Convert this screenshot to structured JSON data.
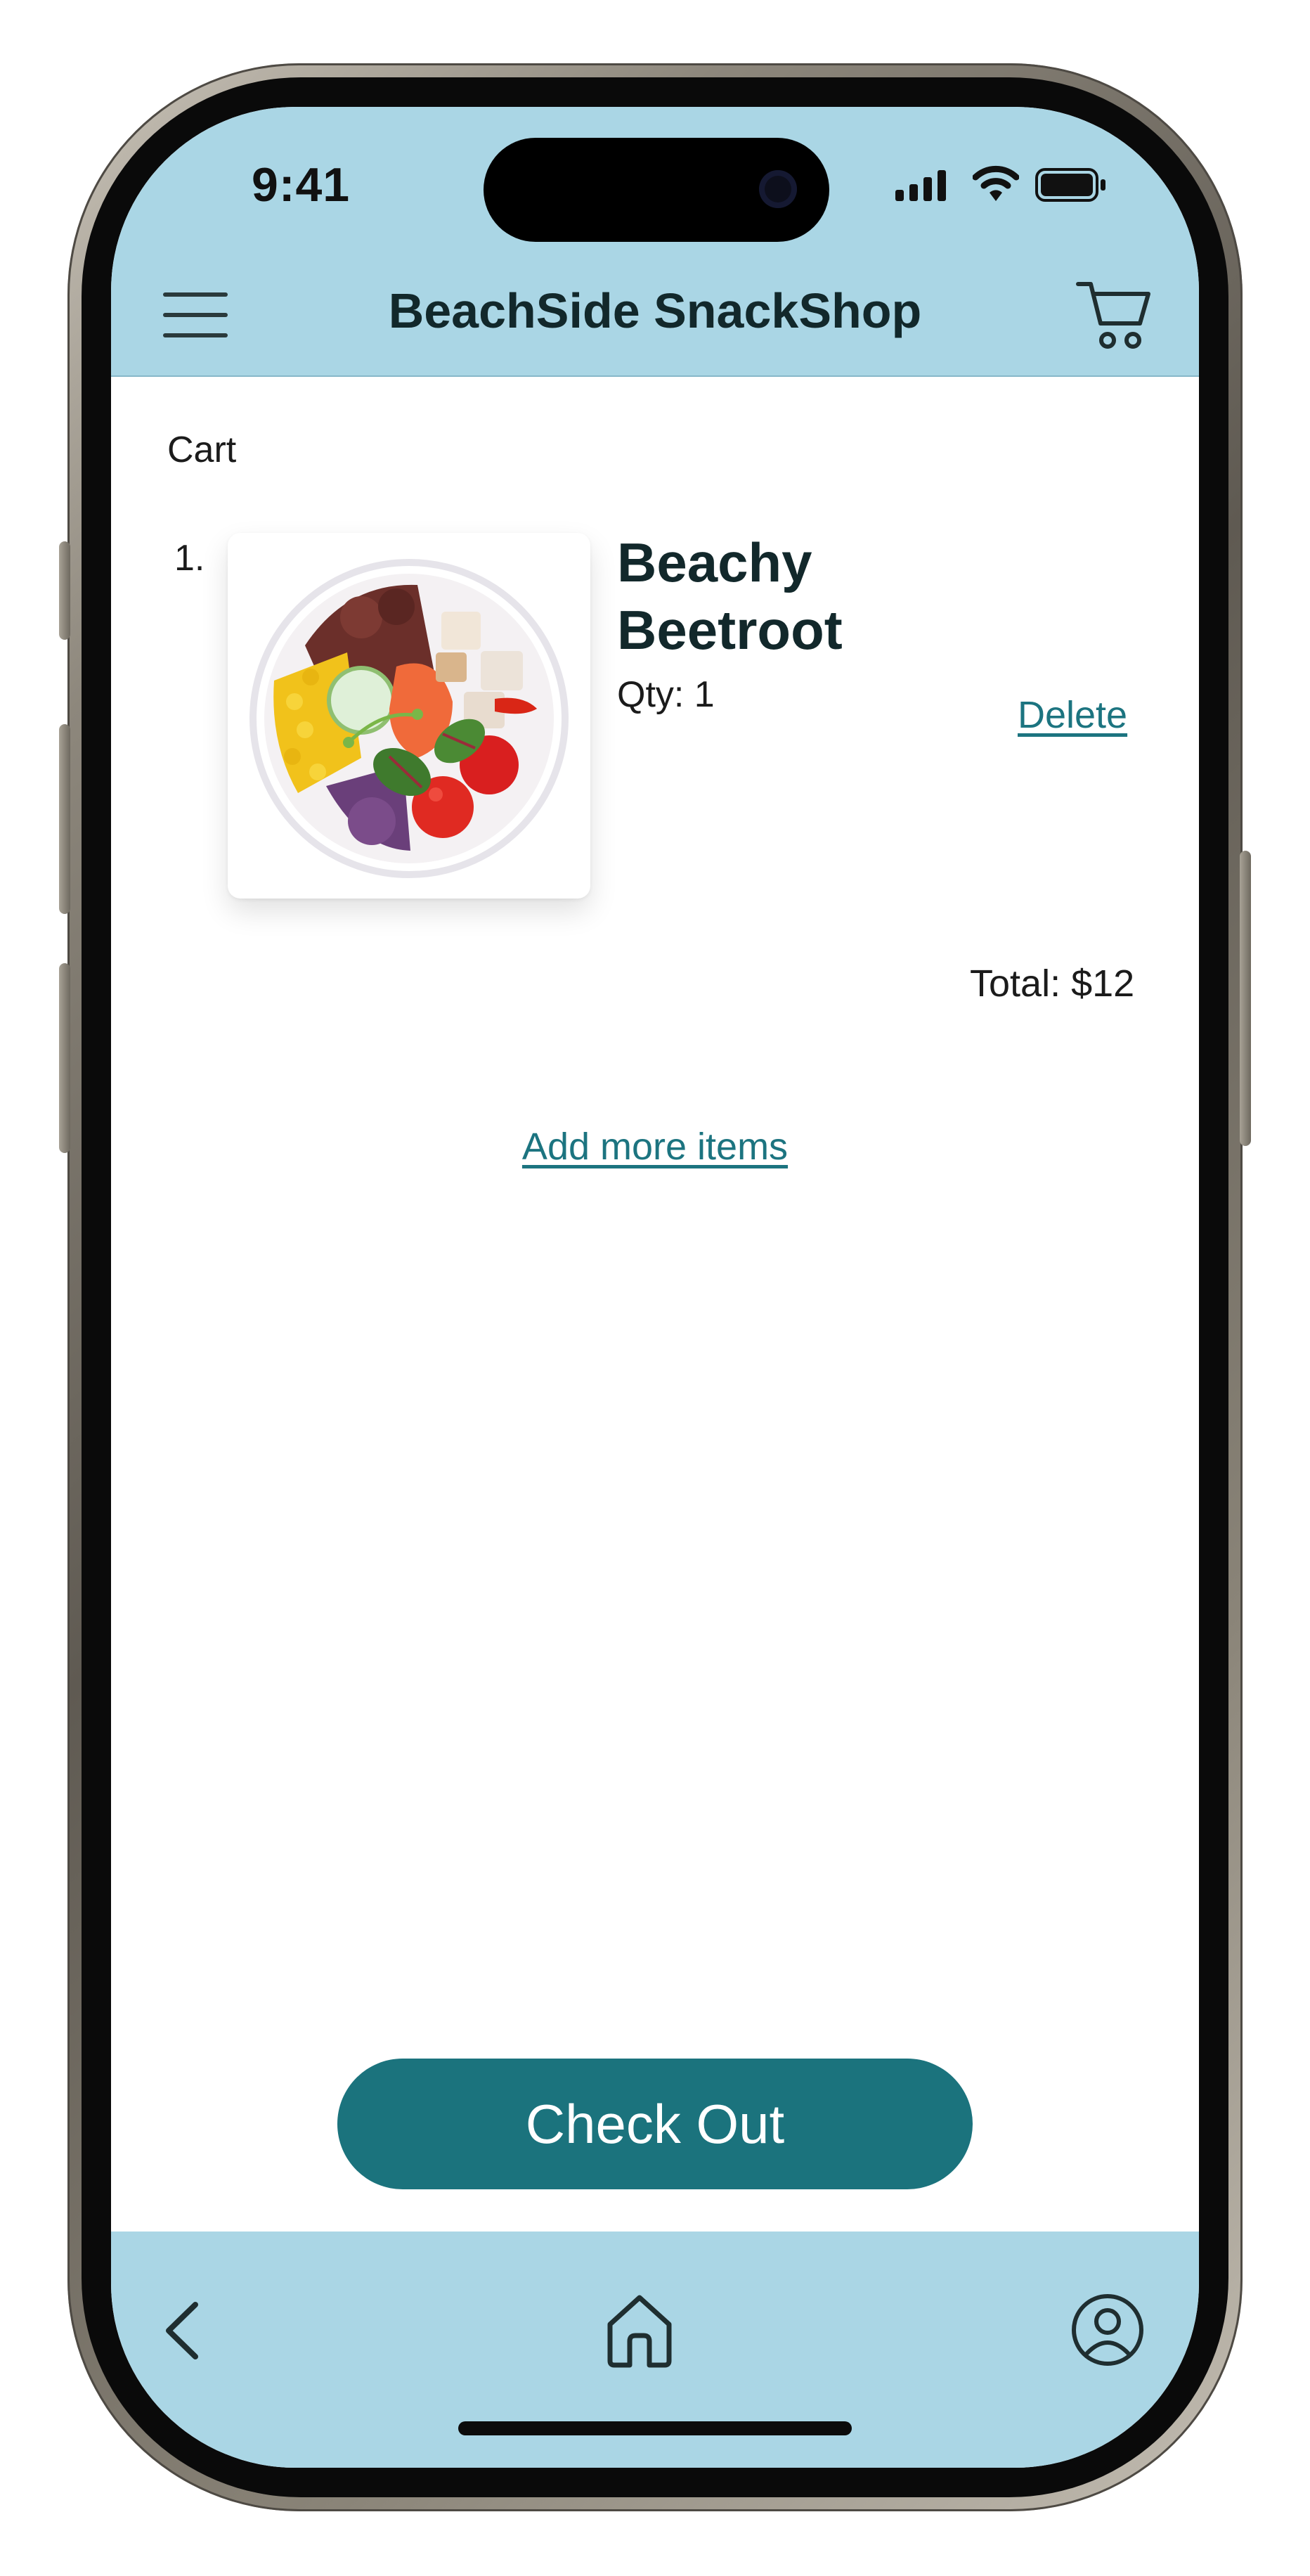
{
  "status_bar": {
    "time": "9:41"
  },
  "header": {
    "title": "BeachSide SnackShop"
  },
  "cart": {
    "heading": "Cart",
    "items": [
      {
        "index": "1.",
        "name_line1": "Beachy",
        "name_line2": "Beetroot",
        "qty": "Qty: 1",
        "delete_label": "Delete",
        "image": "salad-bowl-image"
      }
    ],
    "total": "Total: $12",
    "add_more_label": "Add more items"
  },
  "checkout": {
    "label": "Check Out"
  },
  "bottom_nav": {
    "icons": [
      "chevron-left-icon",
      "home-icon",
      "user-circle-icon"
    ]
  },
  "colors": {
    "header_bg": "#aad6e5",
    "accent": "#1b737d",
    "link": "#1c7480",
    "title_text": "#12282b"
  }
}
